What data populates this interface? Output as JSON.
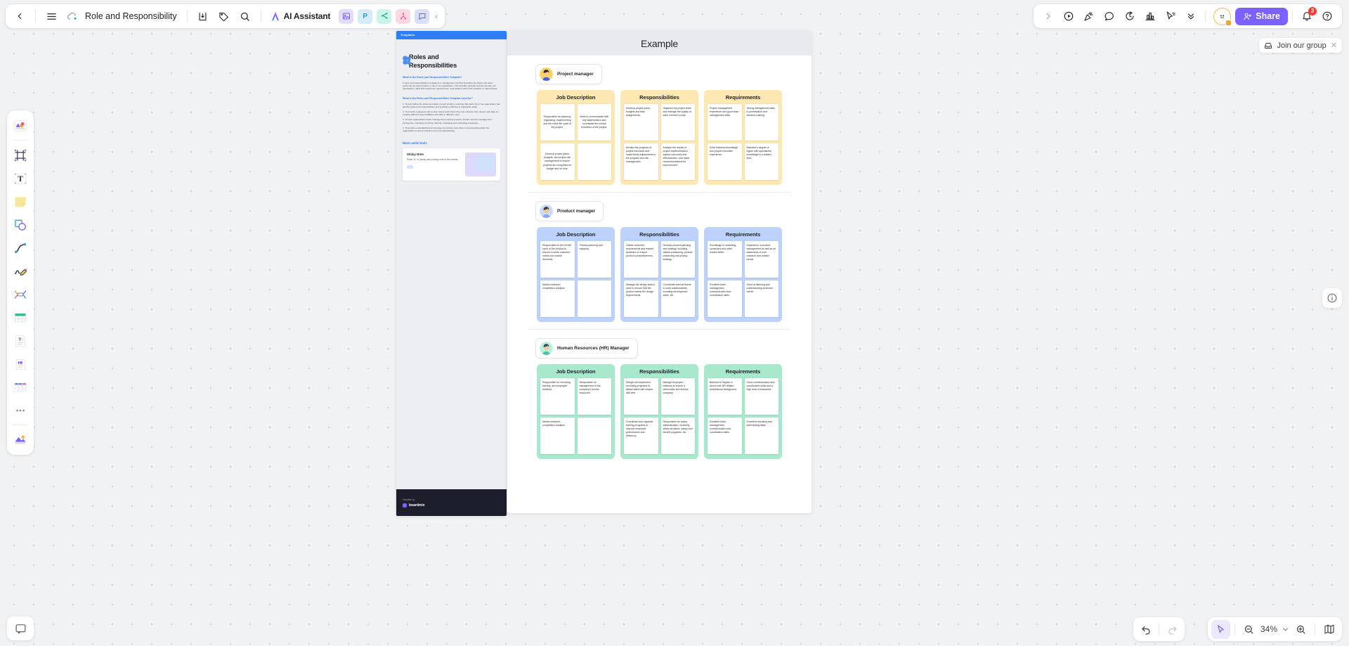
{
  "app": {
    "doc_title": "Role and Responsibility",
    "ai_assistant_label": "AI Assistant",
    "share_label": "Share",
    "notification_count": "3",
    "join_group_label": "Join our group",
    "zoom_level": "34%"
  },
  "toolbar_left": {
    "back": "back-arrow",
    "menu": "hamburger-menu",
    "cloud_status": "cloud-saved",
    "download": "download",
    "tag": "tag",
    "search": "search",
    "apps": [
      {
        "name": "image-app",
        "label": "",
        "bg": "#e4dcfb",
        "fg": "#7b61ff"
      },
      {
        "name": "presentation-app",
        "label": "P",
        "bg": "#d5ecfd",
        "fg": "#2f9ce8"
      },
      {
        "name": "mindmap-app",
        "label": "",
        "bg": "#ccf5e8",
        "fg": "#13b48a"
      },
      {
        "name": "flowchart-app",
        "label": "",
        "bg": "#fdd9e3",
        "fg": "#f2547d"
      },
      {
        "name": "comment-app",
        "label": "",
        "bg": "#dcdefc",
        "fg": "#5b61e8"
      }
    ],
    "collapse": "chevron-left"
  },
  "toolbar_right": {
    "items": [
      {
        "name": "expand-chevron-right",
        "glyph": "chevron-right"
      },
      {
        "name": "present-play-button",
        "glyph": "play-circle"
      },
      {
        "name": "celebrate-button",
        "glyph": "party-popper"
      },
      {
        "name": "comment-bubble-button",
        "glyph": "speech-bubble"
      },
      {
        "name": "timer-button",
        "glyph": "timer"
      },
      {
        "name": "vote-chart-button",
        "glyph": "bar-chart"
      },
      {
        "name": "cursor-follow-button",
        "glyph": "cursor-flag"
      },
      {
        "name": "more-options-button",
        "glyph": "double-chevron-down"
      }
    ]
  },
  "left_rail": {
    "items": [
      {
        "name": "templates-tool",
        "glyph": "templates"
      },
      {
        "name": "frame-tool",
        "glyph": "frame"
      },
      {
        "name": "text-tool",
        "glyph": "text-box"
      },
      {
        "name": "sticky-note-tool",
        "glyph": "sticky-note"
      },
      {
        "name": "shapes-tool",
        "glyph": "shapes"
      },
      {
        "name": "connector-tool",
        "glyph": "curve-line"
      },
      {
        "name": "pen-tool",
        "glyph": "pencil-scribble"
      },
      {
        "name": "mindmap-tool",
        "glyph": "mindmap"
      },
      {
        "name": "table-tool",
        "glyph": "table"
      },
      {
        "name": "document-tool",
        "glyph": "text-document"
      },
      {
        "name": "card-tool",
        "glyph": "card-document"
      },
      {
        "name": "kanban-tool",
        "glyph": "kanban-board"
      },
      {
        "name": "more-tools",
        "glyph": "ellipsis"
      },
      {
        "name": "upload-tool",
        "glyph": "upload-media"
      }
    ],
    "bottom_item": {
      "name": "comment-panel-toggle",
      "glyph": "comment-square"
    }
  },
  "bottom_bar": {
    "undo": "undo-arrow",
    "redo": "redo-arrow",
    "select": "cursor-select",
    "zoom_out": "zoom-out",
    "zoom_in": "zoom-in",
    "zoom_dropdown": "chevron-down",
    "minimap": "minimap"
  },
  "right_panel": {
    "info": "info-circle"
  },
  "template_card": {
    "tag": "Templates",
    "title_line1": "Roles and",
    "title_line2": "Responsibilities",
    "sections": [
      {
        "heading": "What is the Roles and Responsibilities Template?",
        "paragraphs": [
          "A roles and responsibilities template is a management tool that describes the duties and tasks performed by each position or role in an organization. The template typically includes job title, job descriptions, skills and experience requirements, and relations with other positions or departments."
        ]
      },
      {
        "heading": "What is the Roles and Responsibilities Template used for?",
        "paragraphs": [
          "1. To help define the duties and tasks of each position, ensuring that each role in the organization has specific goals and responsibilities and avoiding conflicting or duplicative tasks.",
          "2. To provide employees with a clear career path where they can enhance their careers and take on possibly different responsibilities and skills in different roles.",
          "3. To help organizations better manage their employee teams, human resource management perspective, including recruiting, training, evaluating and motivating employees.",
          "4. To provide a standardized terminology and shared tools when communicating within the organization to avoid confusion and misunderstanding."
        ]
      }
    ],
    "more_tools_link": "More useful tools",
    "tool_card": {
      "title": "Sticky Note",
      "description": "Press \"N\" to quickly add a sticky note to the canvas."
    },
    "footer_label": "Template by",
    "footer_brand": "boardmix"
  },
  "board": {
    "title": "Example",
    "column_headers": [
      "Job Description",
      "Responsibilities",
      "Requirements"
    ],
    "roles": [
      {
        "name": "Project manager",
        "theme": "theme-pm",
        "avatar": {
          "hair": "#2e2a2c",
          "face": "#f6c98f",
          "body": "#3f63e0",
          "bg": "#fbd26a"
        },
        "job_description": [
          "Responsible for planning, organizing, implementing and the entire life cycle of the project.",
          "Need to communicate with key stakeholders and coordinate the overall execution of the project.",
          "Develop project plans, budgets, and project risk management to ensure projects are completed on budget and on time.",
          ""
        ],
        "responsibilities": [
          "Develop project plans, budgets and task assignments.",
          "Organize the project team and manage the quality of each member's work.",
          "Monitor the progress of project execution and make timely adjustments to the program and risk management.",
          "Analyze the results of project implementation, assess outcomes and effectiveness, and make recommendations for improvement."
        ],
        "requirements": [
          "Project management experience and good team management skills.",
          "Strong management skills in prioritization and decision-making.",
          "Solid business knowledge and project execution experience.",
          "Bachelor's degree or higher with specialized knowledge in a related field."
        ]
      },
      {
        "name": "Product manager",
        "theme": "theme-prod",
        "avatar": {
          "hair": "#4a3b2e",
          "face": "#f6c98f",
          "body": "#8ca6f0",
          "bg": "#c9dcff"
        },
        "job_description": [
          "Responsible for the full life cycle of the product to ensure it meets customer needs and market demands.",
          "Product planning and mapping",
          "Market research, competition analysis",
          ""
        ],
        "responsibilities": [
          "Gather customer requirements and market dynamics to ensure product competitiveness.",
          "Develop product planning and strategy, including market positioning, product positioning and pricing strategy.",
          "Manage the design team's work to ensure that the product meets the design requirements.",
          "Coordinate internal teams to work collaboratively, including development, sales, etc."
        ],
        "requirements": [
          "Knowledge in marketing, computers and other related fields.",
          "Experience in product management as well as an awareness of user research and market trends.",
          "Excellent team management, communication and coordination skills.",
          "Good at listening and understanding customer needs."
        ]
      },
      {
        "name": "Human Resources (HR) Manager",
        "theme": "theme-hr",
        "avatar": {
          "hair": "#35506e",
          "face": "#f6c98f",
          "body": "#4fc2a8",
          "bg": "#bff0df"
        },
        "job_description": [
          "Responsible for recruiting, training, and employee relations",
          "Responsible for management of the company's human resources",
          "Market research, competition analysis",
          ""
        ],
        "responsibilities": [
          "Design and implement recruiting programs to attract talent with unique skill sets.",
          "Manage employee relations to ensure a democratic and diverse company.",
          "Coordinate and organize training programs to improve employee performance and efficiency.",
          "Responsible for salary administration, including salary structure, salary and benefit programs, etc."
        ],
        "requirements": [
          "Bachelor's Degree or above with HR related professional background.",
          "Good communication and coordination skills and a high level of teamwork.",
          "Excellent team management, communication and coordination skills.",
          "Excellent recruiting and interviewing skills."
        ]
      }
    ]
  }
}
